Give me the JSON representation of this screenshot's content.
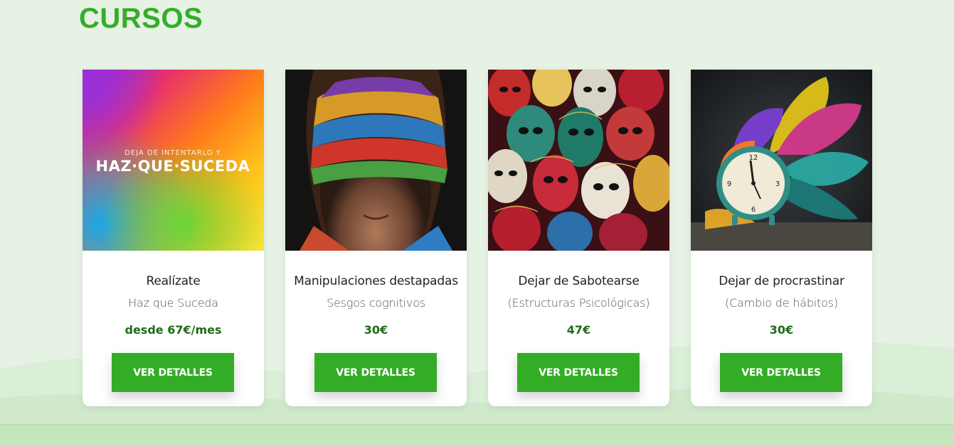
{
  "section": {
    "title": "CURSOS"
  },
  "colors": {
    "accent": "#34ad26",
    "title": "#35ad2a",
    "price": "#1e6b17",
    "background": "#e6f2e4"
  },
  "cards": [
    {
      "image_icon": "haz-que-suceda-cover",
      "image_text_small": "DEJA DE INTENTARLO Y",
      "image_text_big": "HAZ·QUE·SUCEDA",
      "title": "Realízate",
      "subtitle": "Haz que Suceda",
      "price": "desde 67€/mes",
      "button_label": "VER DETALLES"
    },
    {
      "image_icon": "blindfolded-woman-photo",
      "title": "Manipulaciones destapadas",
      "subtitle": "Sesgos cognitivos",
      "price": "30€",
      "button_label": "VER DETALLES"
    },
    {
      "image_icon": "carnival-masks-photo",
      "title": "Dejar de Sabotearse",
      "subtitle": "(Estructuras Psicológicas)",
      "price": "47€",
      "button_label": "VER DETALLES"
    },
    {
      "image_icon": "alarm-clock-color-splash-photo",
      "title": "Dejar de procrastinar",
      "subtitle": "(Cambio de hábitos)",
      "price": "30€",
      "button_label": "VER DETALLES"
    }
  ]
}
